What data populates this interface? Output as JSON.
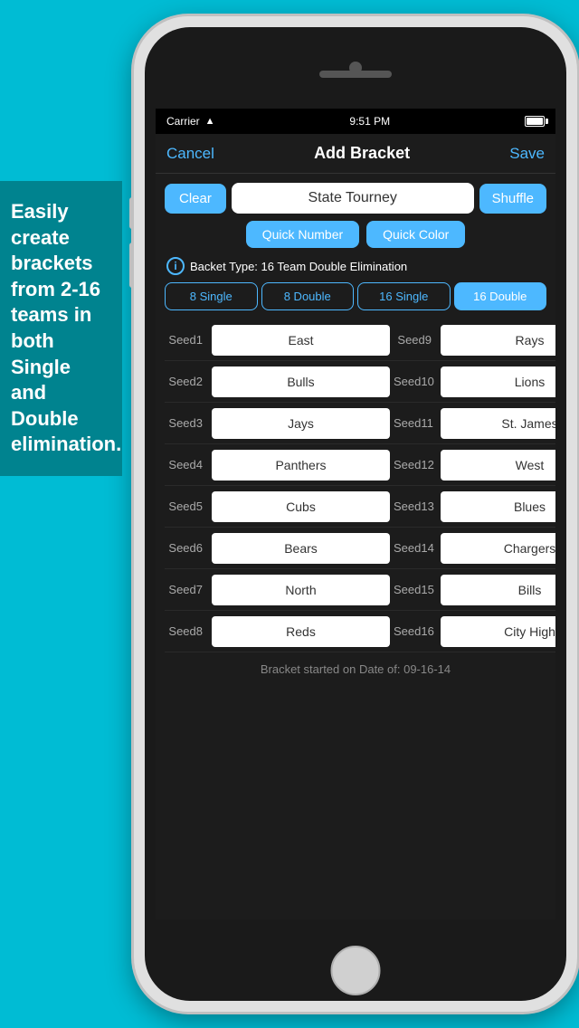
{
  "sidebar": {
    "text": "Easily create brackets from 2-16 teams in both Single and Double elimination."
  },
  "status_bar": {
    "carrier": "Carrier",
    "time": "9:51 PM"
  },
  "nav": {
    "cancel": "Cancel",
    "title": "Add Bracket",
    "save": "Save"
  },
  "buttons": {
    "clear": "Clear",
    "shuffle": "Shuffle",
    "quick_number": "Quick Number",
    "quick_color": "Quick Color"
  },
  "tournament_name": "State Tourney",
  "bracket_type_label": "Backet Type: 16 Team Double Elimination",
  "type_options": [
    "8 Single",
    "8 Double",
    "16 Single",
    "16 Double"
  ],
  "seeds": [
    {
      "label": "Seed1",
      "value": "East"
    },
    {
      "label": "Seed2",
      "value": "Bulls"
    },
    {
      "label": "Seed3",
      "value": "Jays"
    },
    {
      "label": "Seed4",
      "value": "Panthers"
    },
    {
      "label": "Seed5",
      "value": "Cubs"
    },
    {
      "label": "Seed6",
      "value": "Bears"
    },
    {
      "label": "Seed7",
      "value": "North"
    },
    {
      "label": "Seed8",
      "value": "Reds"
    },
    {
      "label": "Seed9",
      "value": "Rays"
    },
    {
      "label": "Seed10",
      "value": "Lions"
    },
    {
      "label": "Seed11",
      "value": "St. James"
    },
    {
      "label": "Seed12",
      "value": "West"
    },
    {
      "label": "Seed13",
      "value": "Blues"
    },
    {
      "label": "Seed14",
      "value": "Chargers"
    },
    {
      "label": "Seed15",
      "value": "Bills"
    },
    {
      "label": "Seed16",
      "value": "City High"
    }
  ],
  "footer": {
    "text": "Bracket started on Date of: 09-16-14"
  }
}
